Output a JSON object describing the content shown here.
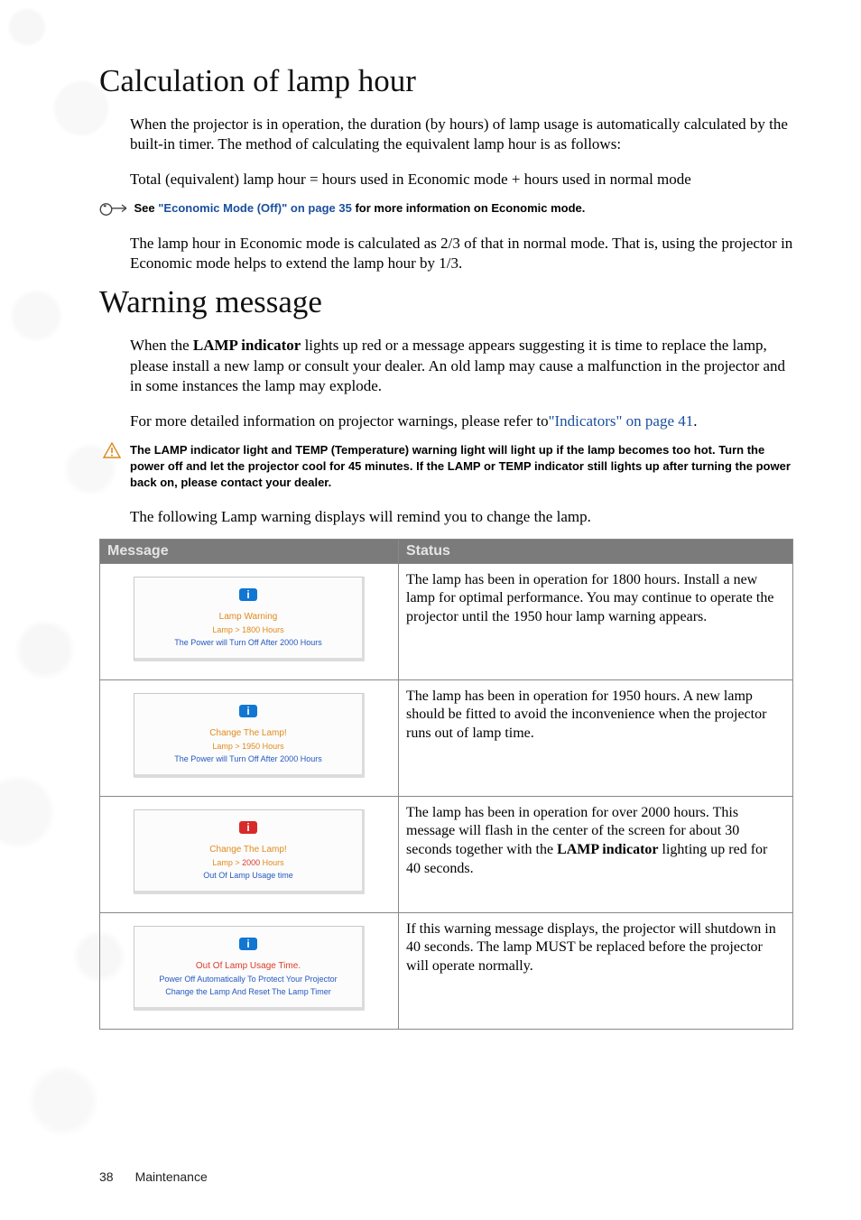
{
  "h1a": "Calculation of lamp hour",
  "p1": "When the projector is in operation, the duration (by hours) of lamp usage is automatically calculated by the built-in timer. The method of calculating the equivalent lamp hour is as follows:",
  "p2": "Total (equivalent) lamp hour = hours used in Economic mode + hours used in normal mode",
  "note1_pre": "See ",
  "note1_link": "\"Economic Mode (Off)\" on page 35",
  "note1_post": " for more information on Economic mode.",
  "p3": "The lamp hour in Economic mode is calculated as 2/3 of that in normal mode. That is, using the projector in Economic mode helps to extend the lamp hour by 1/3.",
  "h1b": "Warning message",
  "p4_pre": "When the ",
  "p4_bold": "LAMP indicator",
  "p4_post": " lights up red or a message appears suggesting it is time to replace the lamp, please install a new lamp or consult your dealer. An old lamp may cause a malfunction in the projector and in some instances the lamp may explode.",
  "p5_pre": "For more detailed information on projector warnings, please refer to",
  "p5_link": "\"Indicators\" on page 41",
  "p5_post": ".",
  "warn": "The LAMP indicator light and TEMP (Temperature) warning light will light up if the lamp becomes too hot. Turn the power off and let the projector cool for 45 minutes. If the LAMP or TEMP indicator still lights up after turning the power back on, please contact your dealer.",
  "p6": "The following Lamp warning displays will remind you to change the lamp.",
  "th1": "Message",
  "th2": "Status",
  "rows": [
    {
      "badge": "blue",
      "l1": "Lamp Warning",
      "l1red": false,
      "l2_a": "Lamp > 1800 Hours",
      "l2_b": "",
      "l3": "The Power will Turn Off After 2000 Hours",
      "status": "The lamp has been in operation for 1800 hours. Install a new lamp for optimal performance. You may continue to operate the projector until the 1950 hour lamp warning appears."
    },
    {
      "badge": "blue",
      "l1": "Change The Lamp!",
      "l1red": false,
      "l2_a": "Lamp > 1950 Hours",
      "l2_b": "",
      "l3": "The Power will Turn Off After 2000 Hours",
      "status": "The lamp has been in operation for 1950 hours. A new lamp should be fitted to avoid the inconvenience when the projector runs out of lamp time."
    },
    {
      "badge": "red",
      "l1": "Change The Lamp!",
      "l1red": false,
      "l2_a": "Lamp > ",
      "l2_b": "2000",
      "l2_c": " Hours",
      "l3": "Out Of Lamp Usage time",
      "status_pre": "The lamp has been in operation for over 2000 hours. This message will flash in the center of the screen for about 30 seconds together with the ",
      "status_bold": "LAMP indicator",
      "status_post": " lighting up red for 40 seconds."
    },
    {
      "badge": "blue",
      "l1": "Out Of Lamp Usage Time.",
      "l1red": true,
      "l2_a": "Power Off Automatically To Protect Your Projector",
      "l2_b": "",
      "l3": "Change the Lamp And Reset The Lamp Timer",
      "status": "If this warning message displays, the projector will shutdown in 40 seconds. The lamp MUST be replaced before the projector will operate normally."
    }
  ],
  "footer_num": "38",
  "footer_lbl": "Maintenance"
}
